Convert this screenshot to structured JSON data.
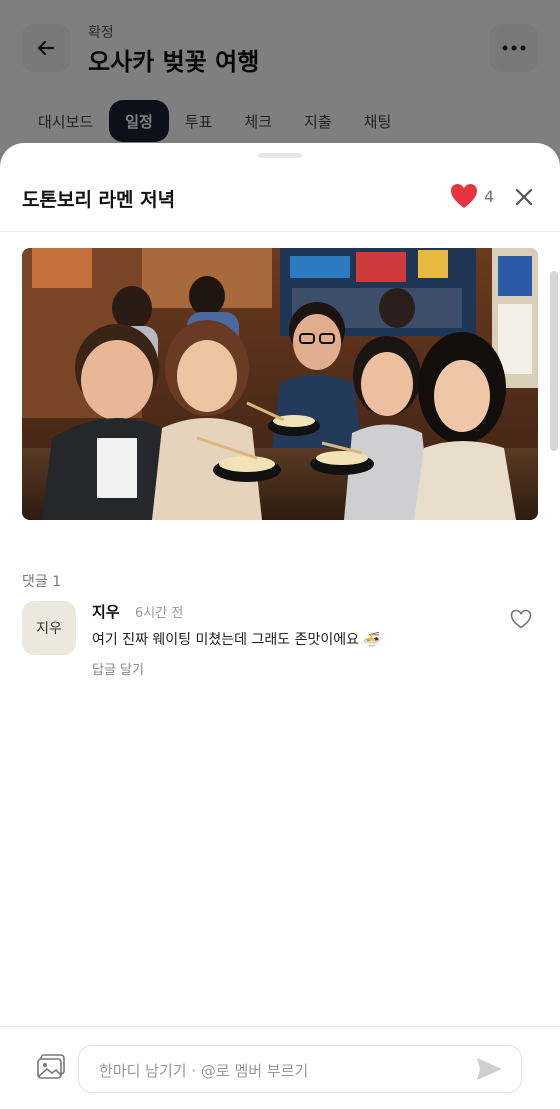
{
  "header": {
    "status": "확정",
    "title": "오사카 벚꽃 여행"
  },
  "tabs": [
    {
      "label": "대시보드"
    },
    {
      "label": "일정"
    },
    {
      "label": "투표"
    },
    {
      "label": "체크"
    },
    {
      "label": "지출"
    },
    {
      "label": "채팅"
    }
  ],
  "active_tab_index": 1,
  "sheet": {
    "title": "도톤보리 라멘 저녁",
    "like_count": "4",
    "photo_icon": "group-photo"
  },
  "comments": {
    "header": "댓글 1",
    "items": [
      {
        "avatar": "지우",
        "author": "지우",
        "time": "6시간 전",
        "text": "여기 진짜 웨이팅 미쳤는데 그래도 존맛이에요 🍜",
        "reply_label": "답글 달기"
      }
    ]
  },
  "composer": {
    "placeholder": "한마디 남기기 · @로 멤버 부르기"
  },
  "colors": {
    "heart": "#e8343f",
    "active_tab": "#1a1f33"
  }
}
